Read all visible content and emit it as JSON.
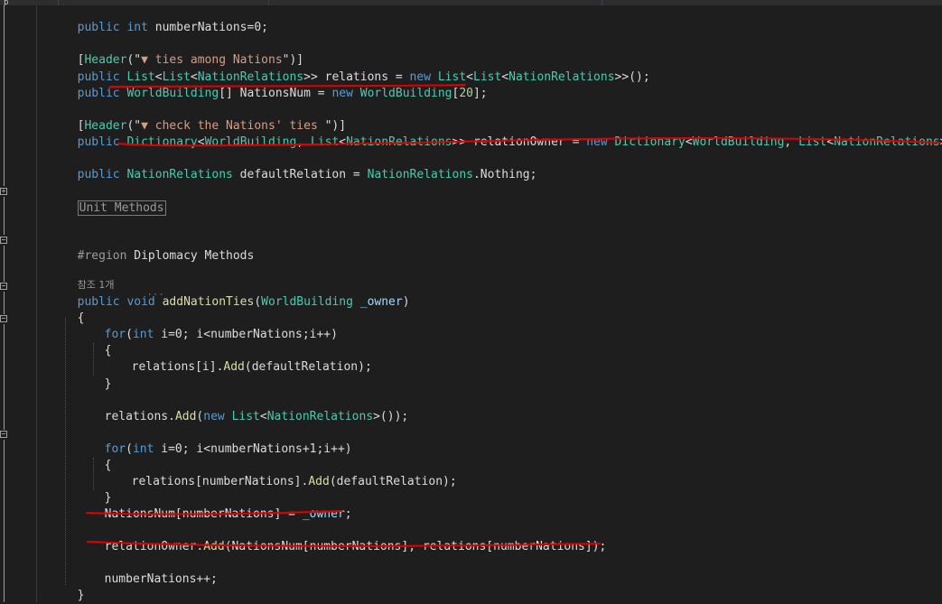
{
  "tabs": [
    {
      "label": "p"
    },
    {
      "label": ""
    },
    {
      "label": ""
    },
    {
      "label": ""
    }
  ],
  "code": {
    "l01": {
      "kw1": "public",
      "kw2": "int",
      "rest": " numberNations=0;"
    },
    "l02": {
      "attr_ty": "Header",
      "p1": "(\"",
      "str": "▼ ties among Nations",
      "p2": "\")]"
    },
    "l03": {
      "kw1": "public",
      "ty1": "List",
      "ty2": "List",
      "ty3": "NationRelations",
      "mid": "> relations = ",
      "kw2": "new",
      "ty4": "List",
      "ty5": "List",
      "ty6": "NationRelations",
      "end": ">>();"
    },
    "l04": {
      "kw1": "public",
      "ty1": "WorldBuilding",
      "mid": "[] NationsNum = ",
      "kw2": "new",
      "ty2": "WorldBuilding",
      "num": "20",
      "end": "];"
    },
    "l05": {
      "attr_ty": "Header",
      "p1": "(\"",
      "str": "▼ check the Nations' ties ",
      "p2": "\")]"
    },
    "l06": {
      "kw1": "public",
      "ty1": "Dictionary",
      "ty2": "WorldBuilding",
      "ty3": "List",
      "ty4": "NationRelations",
      "mid": ">> relationOwner = ",
      "kw2": "new",
      "ty5": "Dictionary",
      "ty6": "WorldBuilding",
      "ty7": "List",
      "ty8": "NationRelations",
      "end": ">>();"
    },
    "l07": {
      "kw1": "public",
      "ty1": "NationRelations",
      "mid": " defaultRelation = ",
      "ty2": "NationRelations",
      "end": ".Nothing;"
    },
    "l08": {
      "collapsed": "Unit Methods"
    },
    "l09": {
      "pre": "#region",
      "rest": " Diplomacy Methods"
    },
    "lens": "참조 1개",
    "l10": {
      "kw1": "public",
      "kw2": "void",
      "mth": "addNationTies",
      "ty1": "WorldBuilding",
      "par": "_owner",
      "end": ")"
    },
    "l11": {
      "text": "{"
    },
    "l12": {
      "kw1": "for",
      "kw2": "int",
      "rest": " i=0; i<numberNations;i++)"
    },
    "l13": {
      "text": "{"
    },
    "l14": {
      "a": "relations[i].",
      "mth": "Add",
      "b": "(defaultRelation);"
    },
    "l15": {
      "text": "}"
    },
    "l16": {
      "a": "relations.",
      "mth": "Add",
      "b": "(",
      "kw": "new",
      "ty1": "List",
      "ty2": "NationRelations",
      "c": ">());"
    },
    "l17": {
      "kw1": "for",
      "kw2": "int",
      "rest": " i=0; i<numberNations+1;i++)"
    },
    "l18": {
      "text": "{"
    },
    "l19": {
      "a": "relations[numberNations].",
      "mth": "Add",
      "b": "(defaultRelation);"
    },
    "l20": {
      "text": "}"
    },
    "l21": {
      "a": "NationsNum[numberNations] = ",
      "par": "_owner",
      "b": ";"
    },
    "l22": {
      "a": "relationOwner.",
      "mth": "Add",
      "b": "(NationsNum[numberNations], relations[numberNations]);"
    },
    "l23": {
      "text": "numberNations++;"
    },
    "l24": {
      "text": "}"
    }
  },
  "colors": {
    "background": "#1e1e1e",
    "keyword": "#569cd6",
    "type": "#4ec9b0",
    "string": "#d69d85",
    "method": "#dcdcaa",
    "parameter": "#9cdcfe",
    "plain": "#dcdcdc",
    "annotation": "#e00000"
  },
  "icons": [
    "fold-expand-icon",
    "fold-collapse-icon"
  ]
}
